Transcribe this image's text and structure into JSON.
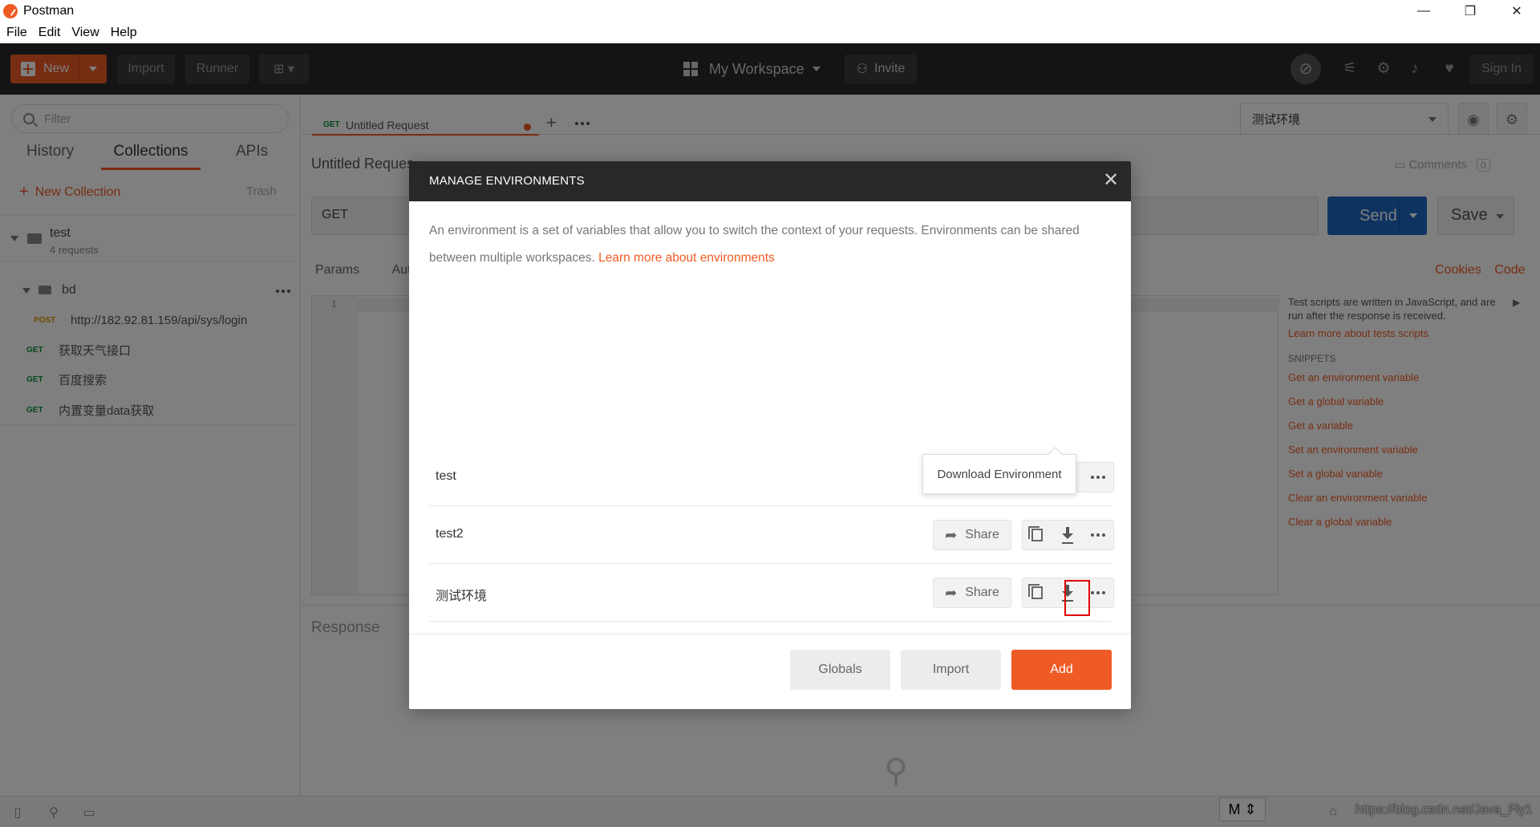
{
  "window": {
    "title": "Postman",
    "controls": {
      "minimize": "—",
      "maximize": "❐",
      "close": "✕"
    }
  },
  "menubar": {
    "items": [
      "File",
      "Edit",
      "View",
      "Help"
    ]
  },
  "toolbar": {
    "new_label": "New",
    "import_label": "Import",
    "runner_label": "Runner",
    "workspace_label": "My Workspace",
    "invite_label": "Invite",
    "signin_label": "Sign In"
  },
  "sidebar": {
    "filter_placeholder": "Filter",
    "tabs": [
      "History",
      "Collections",
      "APIs"
    ],
    "active_tab": "Collections",
    "new_collection_label": "New Collection",
    "trash_label": "Trash",
    "collection": {
      "name": "test",
      "count": "4 requests",
      "folder": "bd",
      "requests": [
        {
          "method": "POST",
          "name": "http://182.92.81.159/api/sys/login"
        },
        {
          "method": "GET",
          "name": "获取天气接口"
        },
        {
          "method": "GET",
          "name": "百度搜索"
        },
        {
          "method": "GET",
          "name": "内置变量data获取"
        }
      ]
    }
  },
  "main": {
    "tab": {
      "method": "GET",
      "label": "Untitled Request"
    },
    "environment_selected": "测试环境",
    "request_title": "Untitled Reques",
    "comments_label": "Comments",
    "comments_count": "0",
    "url_method": "GET",
    "send_label": "Send",
    "save_label": "Save",
    "params_label": "Params",
    "auth_label": "Aut",
    "cookies_label": "Cookies",
    "code_label": "Code",
    "editor_line": "1",
    "response_label": "Response",
    "snippets": {
      "intro": "Test scripts are written in JavaScript, and are run after the response is received.",
      "learn_more": "Learn more about tests scripts",
      "heading": "SNIPPETS",
      "items": [
        "Get an environment variable",
        "Get a global variable",
        "Get a variable",
        "Set an environment variable",
        "Set a global variable",
        "Clear an environment variable",
        "Clear a global variable"
      ]
    }
  },
  "modal": {
    "title": "MANAGE ENVIRONMENTS",
    "description": "An environment is a set of variables that allow you to switch the context of your requests. Environments can be shared between multiple workspaces.",
    "learn_more": "Learn more about environments",
    "share_label": "Share",
    "environments": [
      "test",
      "test2",
      "测试环境"
    ],
    "tooltip": "Download Environment",
    "buttons": {
      "globals": "Globals",
      "import": "Import",
      "add": "Add"
    }
  },
  "statusbar": {
    "ime_label": "M",
    "watermark": "https://blog.csdn.net/Java_Fly1"
  },
  "colors": {
    "accent": "#ef5b25",
    "send": "#1f66c1",
    "toolbar": "#282828",
    "highlight": "#e00000"
  }
}
